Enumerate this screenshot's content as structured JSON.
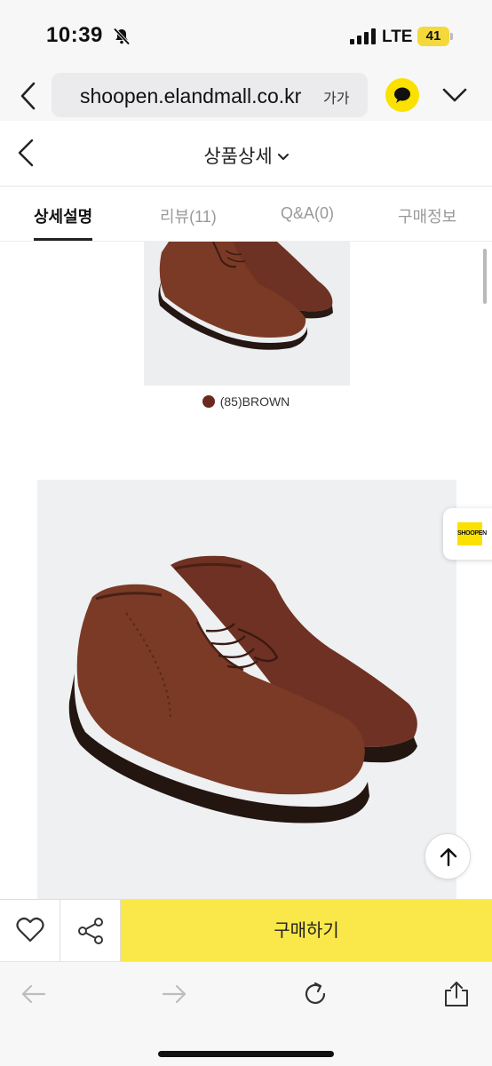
{
  "status_bar": {
    "time": "10:39",
    "network": "LTE",
    "battery": "41"
  },
  "browser": {
    "url": "shoopen.elandmall.co.kr",
    "text_size_label": "가가"
  },
  "header": {
    "title": "상품상세"
  },
  "tabs": [
    {
      "label": "상세설명",
      "active": true
    },
    {
      "label": "리뷰(11)",
      "active": false
    },
    {
      "label": "Q&A(0)",
      "active": false
    },
    {
      "label": "구매정보",
      "active": false
    }
  ],
  "product": {
    "color_option": "(85)BROWN",
    "color_swatch": "#6b2a1e"
  },
  "floating": {
    "brand_badge": "SHOOPEN"
  },
  "action_bar": {
    "buy_label": "구매하기"
  },
  "colors": {
    "accent_yellow": "#fae84a",
    "kakao_yellow": "#fae100",
    "shoe_brown": "#7a3a26"
  }
}
